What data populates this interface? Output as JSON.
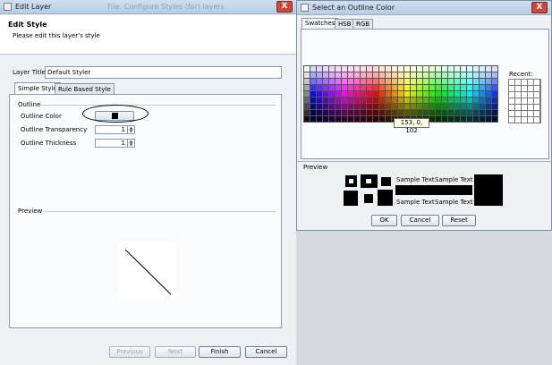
{
  "edit_window": {
    "title": "Edit Layer",
    "background_title": "File: Configure Styles (for) layers",
    "close_glyph": "X",
    "header": {
      "title": "Edit Style",
      "subtitle": "Please edit this layer's style"
    },
    "layer_title": {
      "label": "Layer Title",
      "value": "Default Styler"
    },
    "tabs": [
      {
        "label": "Simple Style",
        "active": true
      },
      {
        "label": "Rule Based Style",
        "active": false
      }
    ],
    "outline": {
      "section_label": "Outline",
      "color_label": "Outline Color",
      "color_value": "#000000",
      "transparency_label": "Outline Transparency",
      "transparency_value": "1",
      "thickness_label": "Outline Thickness",
      "thickness_value": "1"
    },
    "preview_label": "Preview",
    "buttons": {
      "previous": "Previous",
      "next": "Next",
      "finish": "Finish",
      "cancel": "Cancel"
    }
  },
  "color_dialog": {
    "title": "Select an Outline Color",
    "close_glyph": "X",
    "tabs": [
      {
        "label": "Swatches",
        "active": true
      },
      {
        "label": "HSB",
        "active": false
      },
      {
        "label": "RGB",
        "active": false
      }
    ],
    "recent_label": "Recent:",
    "tooltip": "153, 0, 102",
    "preview_label": "Preview",
    "sample_text": "Sample Text",
    "buttons": {
      "ok": "OK",
      "cancel": "Cancel",
      "reset": "Reset"
    }
  },
  "colors": {
    "titlebar": "#c5d8ec",
    "close_button": "#c94a3c",
    "panel": "#eef1f4",
    "tooltip_bg": "#fffde4"
  }
}
